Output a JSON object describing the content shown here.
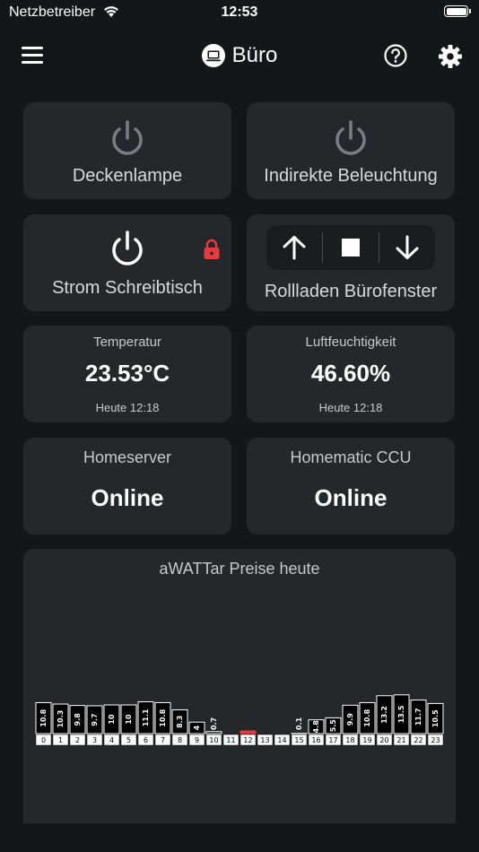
{
  "status_bar": {
    "carrier": "Netzbetreiber",
    "time": "12:53"
  },
  "nav": {
    "title": "Büro"
  },
  "tiles": {
    "deckenlampe": {
      "label": "Deckenlampe"
    },
    "indirekte": {
      "label": "Indirekte Beleuchtung"
    },
    "strom": {
      "label": "Strom Schreibtisch"
    },
    "rollladen": {
      "label": "Rollladen Bürofenster"
    },
    "temperatur": {
      "title": "Temperatur",
      "value": "23.53°C",
      "time": "Heute 12:18"
    },
    "luftfeuchtigkeit": {
      "title": "Luftfeuchtigkeit",
      "value": "46.60%",
      "time": "Heute 12:18"
    },
    "homeserver": {
      "title": "Homeserver",
      "status": "Online"
    },
    "homematic": {
      "title": "Homematic CCU",
      "status": "Online"
    }
  },
  "colors": {
    "accent_red": "#e43c3c",
    "tile_bg": "#24282b",
    "page_bg": "#151617"
  },
  "chart_data": {
    "type": "bar",
    "title": "aWATTar Preise heute",
    "categories": [
      "0",
      "1",
      "2",
      "3",
      "4",
      "5",
      "6",
      "7",
      "8",
      "9",
      "10",
      "11",
      "12",
      "13",
      "14",
      "15",
      "16",
      "17",
      "18",
      "19",
      "20",
      "21",
      "22",
      "23"
    ],
    "values": [
      10.8,
      10.3,
      9.8,
      9.7,
      10,
      10,
      11.1,
      10.8,
      8.3,
      4,
      0.7,
      0,
      0.2,
      0,
      0,
      0.1,
      4.8,
      5.5,
      9.9,
      10.8,
      13.2,
      13.5,
      11.7,
      10.5
    ],
    "value_labels": [
      "10.8",
      "10.3",
      "9.8",
      "9.7",
      "10",
      "10",
      "11.1",
      "10.8",
      "8.3",
      "4",
      "0.7",
      "",
      "",
      "",
      "",
      "0.1",
      "4.8",
      "5.5",
      "9.9",
      "10.8",
      "13.2",
      "13.5",
      "11.7",
      "10.5"
    ],
    "highlight_index": 12,
    "highlight_color": "#e43c3c",
    "bar_color": "#000000"
  }
}
